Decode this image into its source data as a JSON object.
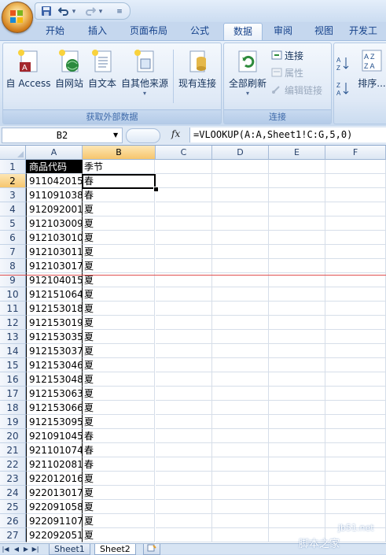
{
  "quick_access": {
    "icons": [
      "save-icon",
      "undo-icon",
      "redo-icon",
      "customize-icon"
    ]
  },
  "tabs": [
    {
      "label": "开始"
    },
    {
      "label": "插入"
    },
    {
      "label": "页面布局"
    },
    {
      "label": "公式"
    },
    {
      "label": "数据",
      "active": true
    },
    {
      "label": "审阅"
    },
    {
      "label": "视图"
    },
    {
      "label": "开发工"
    }
  ],
  "ribbon": {
    "get_external": {
      "group_label": "获取外部数据",
      "access": "自 Access",
      "web": "自网站",
      "text": "自文本",
      "other": "自其他来源",
      "existing": "现有连接"
    },
    "connections": {
      "group_label": "连接",
      "refresh_all": "全部刷新",
      "connections": "连接",
      "properties": "属性",
      "edit_links": "编辑链接"
    },
    "sort": {
      "sort_label": "排序..."
    }
  },
  "formula_bar": {
    "name_box": "B2",
    "fx_label": "fx",
    "formula": "=VLOOKUP(A:A,Sheet1!C:G,5,0)"
  },
  "grid": {
    "columns": [
      "A",
      "B",
      "C",
      "D",
      "E",
      "F"
    ],
    "rows": [
      {
        "n": "1",
        "a": "商品代码",
        "b": "季节"
      },
      {
        "n": "2",
        "a": "911042015",
        "b": "春"
      },
      {
        "n": "3",
        "a": "911091038",
        "b": "春"
      },
      {
        "n": "4",
        "a": "912092001",
        "b": "夏"
      },
      {
        "n": "5",
        "a": "912103009",
        "b": "夏"
      },
      {
        "n": "6",
        "a": "912103010",
        "b": "夏"
      },
      {
        "n": "7",
        "a": "912103011",
        "b": "夏"
      },
      {
        "n": "8",
        "a": "912103017",
        "b": "夏"
      },
      {
        "n": "9",
        "a": "912104015",
        "b": "夏"
      },
      {
        "n": "10",
        "a": "912151064",
        "b": "夏"
      },
      {
        "n": "11",
        "a": "912153018",
        "b": "夏"
      },
      {
        "n": "12",
        "a": "912153019",
        "b": "夏"
      },
      {
        "n": "13",
        "a": "912153035",
        "b": "夏"
      },
      {
        "n": "14",
        "a": "912153037",
        "b": "夏"
      },
      {
        "n": "15",
        "a": "912153046",
        "b": "夏"
      },
      {
        "n": "16",
        "a": "912153048",
        "b": "夏"
      },
      {
        "n": "17",
        "a": "912153063",
        "b": "夏"
      },
      {
        "n": "18",
        "a": "912153066",
        "b": "夏"
      },
      {
        "n": "19",
        "a": "912153095",
        "b": "夏"
      },
      {
        "n": "20",
        "a": "921091045",
        "b": "春"
      },
      {
        "n": "21",
        "a": "921101074",
        "b": "春"
      },
      {
        "n": "22",
        "a": "921102081",
        "b": "春"
      },
      {
        "n": "23",
        "a": "922012016",
        "b": "夏"
      },
      {
        "n": "24",
        "a": "922013017",
        "b": "夏"
      },
      {
        "n": "25",
        "a": "922091058",
        "b": "夏"
      },
      {
        "n": "26",
        "a": "922091107",
        "b": "夏"
      },
      {
        "n": "27",
        "a": "922092051",
        "b": "夏"
      }
    ]
  },
  "sheets": [
    {
      "label": "Sheet1"
    },
    {
      "label": "Sheet2",
      "active": true
    }
  ],
  "watermark": {
    "site": "jb51.net",
    "text": "脚本之家"
  }
}
